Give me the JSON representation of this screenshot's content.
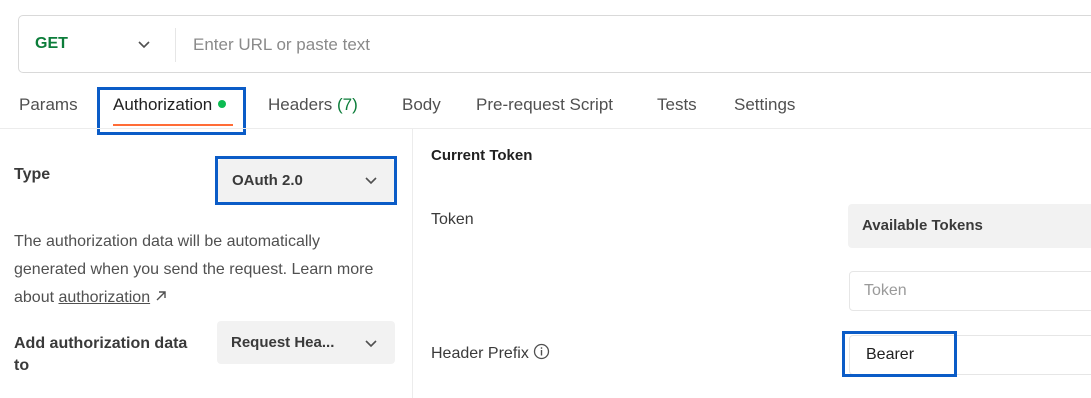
{
  "request": {
    "method": "GET",
    "url_value": "",
    "url_placeholder": "Enter URL or paste text"
  },
  "tabs": [
    {
      "label": "Params"
    },
    {
      "label": "Authorization",
      "active": true,
      "indicator": "green-dot"
    },
    {
      "label": "Headers",
      "count": "(7)"
    },
    {
      "label": "Body"
    },
    {
      "label": "Pre-request Script"
    },
    {
      "label": "Tests"
    },
    {
      "label": "Settings"
    }
  ],
  "auth": {
    "type_label": "Type",
    "type_value": "OAuth 2.0",
    "description": "The authorization data will be automatically generated when you send the request. Learn more about ",
    "description_link": "authorization",
    "add_to_label": "Add authorization data to",
    "add_to_value": "Request Hea..."
  },
  "token": {
    "heading": "Current Token",
    "token_label": "Token",
    "available_tokens": "Available Tokens",
    "token_placeholder": "Token",
    "header_prefix_label": "Header Prefix",
    "header_prefix_value": "Bearer"
  },
  "colors": {
    "method_green": "#0c7d3a",
    "active_underline": "#ff6c37",
    "highlight_blue": "#0b5cc7",
    "status_dot": "#0cbb52"
  },
  "icons": [
    "chevron-down-icon",
    "external-link-arrow-icon",
    "info-icon"
  ]
}
